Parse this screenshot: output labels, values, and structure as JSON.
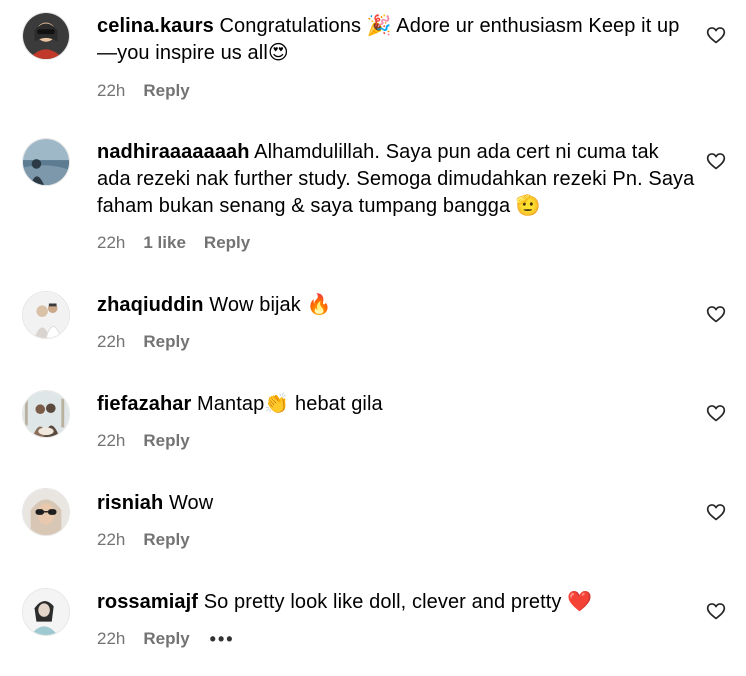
{
  "comments": [
    {
      "username": "celina.kaurs",
      "text": " Congratulations 🎉 Adore ur enthusiasm Keep it up—you inspire us all😍",
      "time": "22h",
      "likes": "",
      "reply_label": "Reply",
      "avatar_colors": [
        "#c0392b",
        "#2c2c2c",
        "#e8c4a0"
      ]
    },
    {
      "username": "nadhiraaaaaaah",
      "text": " Alhamdulillah. Saya pun ada cert ni cuma tak ada rezeki nak further study. Semoga dimudahkan rezeki Pn. Saya faham bukan senang & saya tumpang bangga 🫡",
      "time": "22h",
      "likes": "1 like",
      "reply_label": "Reply",
      "avatar_colors": [
        "#9fb8c8",
        "#5d7c92",
        "#2b3a44"
      ]
    },
    {
      "username": "zhaqiuddin",
      "text": " Wow bijak 🔥",
      "time": "22h",
      "likes": "",
      "reply_label": "Reply",
      "avatar_colors": [
        "#f2f2f2",
        "#d9d4cf",
        "#3a3a3a"
      ]
    },
    {
      "username": "fiefazahar",
      "text": " Mantap👏 hebat gila",
      "time": "22h",
      "likes": "",
      "reply_label": "Reply",
      "avatar_colors": [
        "#dfe6e8",
        "#b9b19e",
        "#5a4a3e"
      ]
    },
    {
      "username": "risniah",
      "text": " Wow",
      "time": "22h",
      "likes": "",
      "reply_label": "Reply",
      "avatar_colors": [
        "#e9e5e1",
        "#d8c7b5",
        "#1e1e1e"
      ]
    },
    {
      "username": "rossamiajf",
      "text": " So pretty look like doll, clever and pretty ❤️",
      "time": "22h",
      "likes": "",
      "reply_label": "Reply",
      "more_label": "•••",
      "avatar_colors": [
        "#f4f4f4",
        "#e3d6c8",
        "#2c2c2c"
      ]
    }
  ],
  "icons": {
    "like": "heart-outline-icon",
    "more": "more-options-icon"
  },
  "colors": {
    "meta": "#737373",
    "text": "#000000",
    "background": "#ffffff"
  }
}
